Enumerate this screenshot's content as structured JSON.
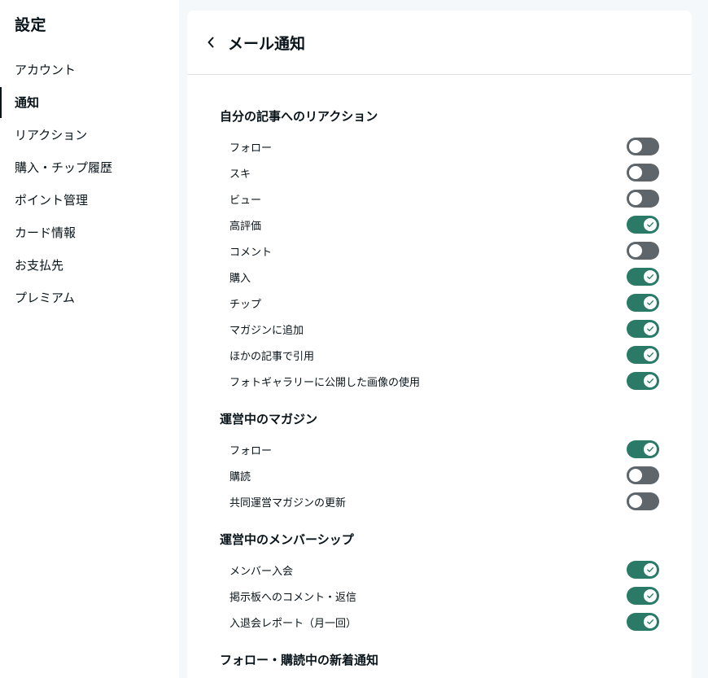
{
  "sidebar": {
    "title": "設定",
    "items": [
      {
        "label": "アカウント",
        "active": false
      },
      {
        "label": "通知",
        "active": true
      },
      {
        "label": "リアクション",
        "active": false
      },
      {
        "label": "購入・チップ履歴",
        "active": false
      },
      {
        "label": "ポイント管理",
        "active": false
      },
      {
        "label": "カード情報",
        "active": false
      },
      {
        "label": "お支払先",
        "active": false
      },
      {
        "label": "プレミアム",
        "active": false
      }
    ]
  },
  "header": {
    "title": "メール通知",
    "back_icon": "chevron-left-icon"
  },
  "colors": {
    "toggle_on": "#2b7a67",
    "toggle_off": "#5e656b"
  },
  "sections": [
    {
      "title": "自分の記事へのリアクション",
      "items": [
        {
          "label": "フォロー",
          "enabled": false
        },
        {
          "label": "スキ",
          "enabled": false
        },
        {
          "label": "ビュー",
          "enabled": false
        },
        {
          "label": "高評価",
          "enabled": true
        },
        {
          "label": "コメント",
          "enabled": false
        },
        {
          "label": "購入",
          "enabled": true
        },
        {
          "label": "チップ",
          "enabled": true
        },
        {
          "label": "マガジンに追加",
          "enabled": true
        },
        {
          "label": "ほかの記事で引用",
          "enabled": true
        },
        {
          "label": "フォトギャラリーに公開した画像の使用",
          "enabled": true
        }
      ]
    },
    {
      "title": "運営中のマガジン",
      "items": [
        {
          "label": "フォロー",
          "enabled": true
        },
        {
          "label": "購読",
          "enabled": false
        },
        {
          "label": "共同運営マガジンの更新",
          "enabled": false
        }
      ]
    },
    {
      "title": "運営中のメンバーシップ",
      "items": [
        {
          "label": "メンバー入会",
          "enabled": true
        },
        {
          "label": "掲示板へのコメント・返信",
          "enabled": true
        },
        {
          "label": "入退会レポート（月一回）",
          "enabled": true
        }
      ]
    },
    {
      "title": "フォロー・購読中の新着通知",
      "items": []
    }
  ]
}
